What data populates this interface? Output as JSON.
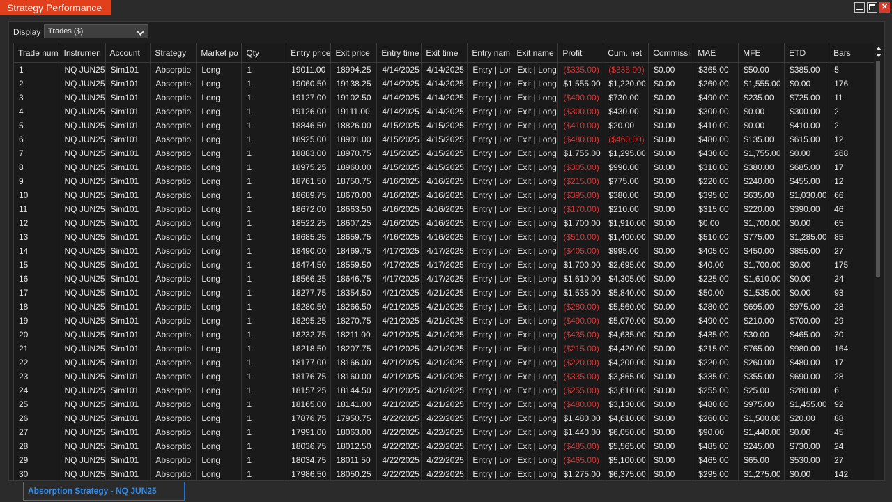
{
  "window": {
    "title": "Strategy Performance"
  },
  "toolbar": {
    "display_label": "Display",
    "display_value": "Trades ($)"
  },
  "table": {
    "columns": [
      "Trade num",
      "Instrumen",
      "Account",
      "Strategy",
      "Market po",
      "Qty",
      "Entry price",
      "Exit price",
      "Entry time",
      "Exit time",
      "Entry nam",
      "Exit name",
      "Profit",
      "Cum. net",
      "Commissi",
      "MAE",
      "MFE",
      "ETD",
      "Bars"
    ],
    "rows": [
      [
        "1",
        "NQ JUN25",
        "Sim101",
        "Absorptio",
        "Long",
        "1",
        "19011.00",
        "18994.25",
        "4/14/2025",
        "4/14/2025",
        "Entry | Lor",
        "Exit | Long",
        "($335.00)",
        "($335.00)",
        "$0.00",
        "$365.00",
        "$50.00",
        "$385.00",
        "5"
      ],
      [
        "2",
        "NQ JUN25",
        "Sim101",
        "Absorptio",
        "Long",
        "1",
        "19060.50",
        "19138.25",
        "4/14/2025",
        "4/14/2025",
        "Entry | Lor",
        "Exit | Long",
        "$1,555.00",
        "$1,220.00",
        "$0.00",
        "$260.00",
        "$1,555.00",
        "$0.00",
        "176"
      ],
      [
        "3",
        "NQ JUN25",
        "Sim101",
        "Absorptio",
        "Long",
        "1",
        "19127.00",
        "19102.50",
        "4/14/2025",
        "4/14/2025",
        "Entry | Lor",
        "Exit | Long",
        "($490.00)",
        "$730.00",
        "$0.00",
        "$490.00",
        "$235.00",
        "$725.00",
        "11"
      ],
      [
        "4",
        "NQ JUN25",
        "Sim101",
        "Absorptio",
        "Long",
        "1",
        "19126.00",
        "19111.00",
        "4/14/2025",
        "4/14/2025",
        "Entry | Lor",
        "Exit | Long",
        "($300.00)",
        "$430.00",
        "$0.00",
        "$300.00",
        "$0.00",
        "$300.00",
        "2"
      ],
      [
        "5",
        "NQ JUN25",
        "Sim101",
        "Absorptio",
        "Long",
        "1",
        "18846.50",
        "18826.00",
        "4/15/2025",
        "4/15/2025",
        "Entry | Lor",
        "Exit | Long",
        "($410.00)",
        "$20.00",
        "$0.00",
        "$410.00",
        "$0.00",
        "$410.00",
        "2"
      ],
      [
        "6",
        "NQ JUN25",
        "Sim101",
        "Absorptio",
        "Long",
        "1",
        "18925.00",
        "18901.00",
        "4/15/2025",
        "4/15/2025",
        "Entry | Lor",
        "Exit | Long",
        "($480.00)",
        "($460.00)",
        "$0.00",
        "$480.00",
        "$135.00",
        "$615.00",
        "12"
      ],
      [
        "7",
        "NQ JUN25",
        "Sim101",
        "Absorptio",
        "Long",
        "1",
        "18883.00",
        "18970.75",
        "4/15/2025",
        "4/15/2025",
        "Entry | Lor",
        "Exit | Long",
        "$1,755.00",
        "$1,295.00",
        "$0.00",
        "$430.00",
        "$1,755.00",
        "$0.00",
        "268"
      ],
      [
        "8",
        "NQ JUN25",
        "Sim101",
        "Absorptio",
        "Long",
        "1",
        "18975.25",
        "18960.00",
        "4/15/2025",
        "4/15/2025",
        "Entry | Lor",
        "Exit | Long",
        "($305.00)",
        "$990.00",
        "$0.00",
        "$310.00",
        "$380.00",
        "$685.00",
        "17"
      ],
      [
        "9",
        "NQ JUN25",
        "Sim101",
        "Absorptio",
        "Long",
        "1",
        "18761.50",
        "18750.75",
        "4/16/2025",
        "4/16/2025",
        "Entry | Lor",
        "Exit | Long",
        "($215.00)",
        "$775.00",
        "$0.00",
        "$220.00",
        "$240.00",
        "$455.00",
        "12"
      ],
      [
        "10",
        "NQ JUN25",
        "Sim101",
        "Absorptio",
        "Long",
        "1",
        "18689.75",
        "18670.00",
        "4/16/2025",
        "4/16/2025",
        "Entry | Lor",
        "Exit | Long",
        "($395.00)",
        "$380.00",
        "$0.00",
        "$395.00",
        "$635.00",
        "$1,030.00",
        "66"
      ],
      [
        "11",
        "NQ JUN25",
        "Sim101",
        "Absorptio",
        "Long",
        "1",
        "18672.00",
        "18663.50",
        "4/16/2025",
        "4/16/2025",
        "Entry | Lor",
        "Exit | Long",
        "($170.00)",
        "$210.00",
        "$0.00",
        "$315.00",
        "$220.00",
        "$390.00",
        "46"
      ],
      [
        "12",
        "NQ JUN25",
        "Sim101",
        "Absorptio",
        "Long",
        "1",
        "18522.25",
        "18607.25",
        "4/16/2025",
        "4/16/2025",
        "Entry | Lor",
        "Exit | Long",
        "$1,700.00",
        "$1,910.00",
        "$0.00",
        "$0.00",
        "$1,700.00",
        "$0.00",
        "65"
      ],
      [
        "13",
        "NQ JUN25",
        "Sim101",
        "Absorptio",
        "Long",
        "1",
        "18685.25",
        "18659.75",
        "4/16/2025",
        "4/16/2025",
        "Entry | Lor",
        "Exit | Long",
        "($510.00)",
        "$1,400.00",
        "$0.00",
        "$510.00",
        "$775.00",
        "$1,285.00",
        "85"
      ],
      [
        "14",
        "NQ JUN25",
        "Sim101",
        "Absorptio",
        "Long",
        "1",
        "18490.00",
        "18469.75",
        "4/17/2025",
        "4/17/2025",
        "Entry | Lor",
        "Exit | Long",
        "($405.00)",
        "$995.00",
        "$0.00",
        "$405.00",
        "$450.00",
        "$855.00",
        "27"
      ],
      [
        "15",
        "NQ JUN25",
        "Sim101",
        "Absorptio",
        "Long",
        "1",
        "18474.50",
        "18559.50",
        "4/17/2025",
        "4/17/2025",
        "Entry | Lor",
        "Exit | Long",
        "$1,700.00",
        "$2,695.00",
        "$0.00",
        "$40.00",
        "$1,700.00",
        "$0.00",
        "175"
      ],
      [
        "16",
        "NQ JUN25",
        "Sim101",
        "Absorptio",
        "Long",
        "1",
        "18566.25",
        "18646.75",
        "4/17/2025",
        "4/17/2025",
        "Entry | Lor",
        "Exit | Long",
        "$1,610.00",
        "$4,305.00",
        "$0.00",
        "$225.00",
        "$1,610.00",
        "$0.00",
        "24"
      ],
      [
        "17",
        "NQ JUN25",
        "Sim101",
        "Absorptio",
        "Long",
        "1",
        "18277.75",
        "18354.50",
        "4/21/2025",
        "4/21/2025",
        "Entry | Lor",
        "Exit | Long",
        "$1,535.00",
        "$5,840.00",
        "$0.00",
        "$50.00",
        "$1,535.00",
        "$0.00",
        "93"
      ],
      [
        "18",
        "NQ JUN25",
        "Sim101",
        "Absorptio",
        "Long",
        "1",
        "18280.50",
        "18266.50",
        "4/21/2025",
        "4/21/2025",
        "Entry | Lor",
        "Exit | Long",
        "($280.00)",
        "$5,560.00",
        "$0.00",
        "$280.00",
        "$695.00",
        "$975.00",
        "28"
      ],
      [
        "19",
        "NQ JUN25",
        "Sim101",
        "Absorptio",
        "Long",
        "1",
        "18295.25",
        "18270.75",
        "4/21/2025",
        "4/21/2025",
        "Entry | Lor",
        "Exit | Long",
        "($490.00)",
        "$5,070.00",
        "$0.00",
        "$490.00",
        "$210.00",
        "$700.00",
        "29"
      ],
      [
        "20",
        "NQ JUN25",
        "Sim101",
        "Absorptio",
        "Long",
        "1",
        "18232.75",
        "18211.00",
        "4/21/2025",
        "4/21/2025",
        "Entry | Lor",
        "Exit | Long",
        "($435.00)",
        "$4,635.00",
        "$0.00",
        "$435.00",
        "$30.00",
        "$465.00",
        "30"
      ],
      [
        "21",
        "NQ JUN25",
        "Sim101",
        "Absorptio",
        "Long",
        "1",
        "18218.50",
        "18207.75",
        "4/21/2025",
        "4/21/2025",
        "Entry | Lor",
        "Exit | Long",
        "($215.00)",
        "$4,420.00",
        "$0.00",
        "$215.00",
        "$765.00",
        "$980.00",
        "164"
      ],
      [
        "22",
        "NQ JUN25",
        "Sim101",
        "Absorptio",
        "Long",
        "1",
        "18177.00",
        "18166.00",
        "4/21/2025",
        "4/21/2025",
        "Entry | Lor",
        "Exit | Long",
        "($220.00)",
        "$4,200.00",
        "$0.00",
        "$220.00",
        "$260.00",
        "$480.00",
        "17"
      ],
      [
        "23",
        "NQ JUN25",
        "Sim101",
        "Absorptio",
        "Long",
        "1",
        "18176.75",
        "18160.00",
        "4/21/2025",
        "4/21/2025",
        "Entry | Lor",
        "Exit | Long",
        "($335.00)",
        "$3,865.00",
        "$0.00",
        "$335.00",
        "$355.00",
        "$690.00",
        "28"
      ],
      [
        "24",
        "NQ JUN25",
        "Sim101",
        "Absorptio",
        "Long",
        "1",
        "18157.25",
        "18144.50",
        "4/21/2025",
        "4/21/2025",
        "Entry | Lor",
        "Exit | Long",
        "($255.00)",
        "$3,610.00",
        "$0.00",
        "$255.00",
        "$25.00",
        "$280.00",
        "6"
      ],
      [
        "25",
        "NQ JUN25",
        "Sim101",
        "Absorptio",
        "Long",
        "1",
        "18165.00",
        "18141.00",
        "4/21/2025",
        "4/21/2025",
        "Entry | Lor",
        "Exit | Long",
        "($480.00)",
        "$3,130.00",
        "$0.00",
        "$480.00",
        "$975.00",
        "$1,455.00",
        "92"
      ],
      [
        "26",
        "NQ JUN25",
        "Sim101",
        "Absorptio",
        "Long",
        "1",
        "17876.75",
        "17950.75",
        "4/22/2025",
        "4/22/2025",
        "Entry | Lor",
        "Exit | Long",
        "$1,480.00",
        "$4,610.00",
        "$0.00",
        "$260.00",
        "$1,500.00",
        "$20.00",
        "88"
      ],
      [
        "27",
        "NQ JUN25",
        "Sim101",
        "Absorptio",
        "Long",
        "1",
        "17991.00",
        "18063.00",
        "4/22/2025",
        "4/22/2025",
        "Entry | Lor",
        "Exit | Long",
        "$1,440.00",
        "$6,050.00",
        "$0.00",
        "$90.00",
        "$1,440.00",
        "$0.00",
        "45"
      ],
      [
        "28",
        "NQ JUN25",
        "Sim101",
        "Absorptio",
        "Long",
        "1",
        "18036.75",
        "18012.50",
        "4/22/2025",
        "4/22/2025",
        "Entry | Lor",
        "Exit | Long",
        "($485.00)",
        "$5,565.00",
        "$0.00",
        "$485.00",
        "$245.00",
        "$730.00",
        "24"
      ],
      [
        "29",
        "NQ JUN25",
        "Sim101",
        "Absorptio",
        "Long",
        "1",
        "18034.75",
        "18011.50",
        "4/22/2025",
        "4/22/2025",
        "Entry | Lor",
        "Exit | Long",
        "($465.00)",
        "$5,100.00",
        "$0.00",
        "$465.00",
        "$65.00",
        "$530.00",
        "27"
      ],
      [
        "30",
        "NQ JUN25",
        "Sim101",
        "Absorptio",
        "Long",
        "1",
        "17986.50",
        "18050.25",
        "4/22/2025",
        "4/22/2025",
        "Entry | Lor",
        "Exit | Long",
        "$1,275.00",
        "$6,375.00",
        "$0.00",
        "$295.00",
        "$1,275.00",
        "$0.00",
        "142"
      ]
    ]
  },
  "bottom_tab": {
    "label": "Absorption Strategy - NQ JUN25"
  },
  "colors": {
    "title_accent": "#e2401c",
    "negative": "#e03131",
    "tab_accent": "#2e8cf0"
  }
}
